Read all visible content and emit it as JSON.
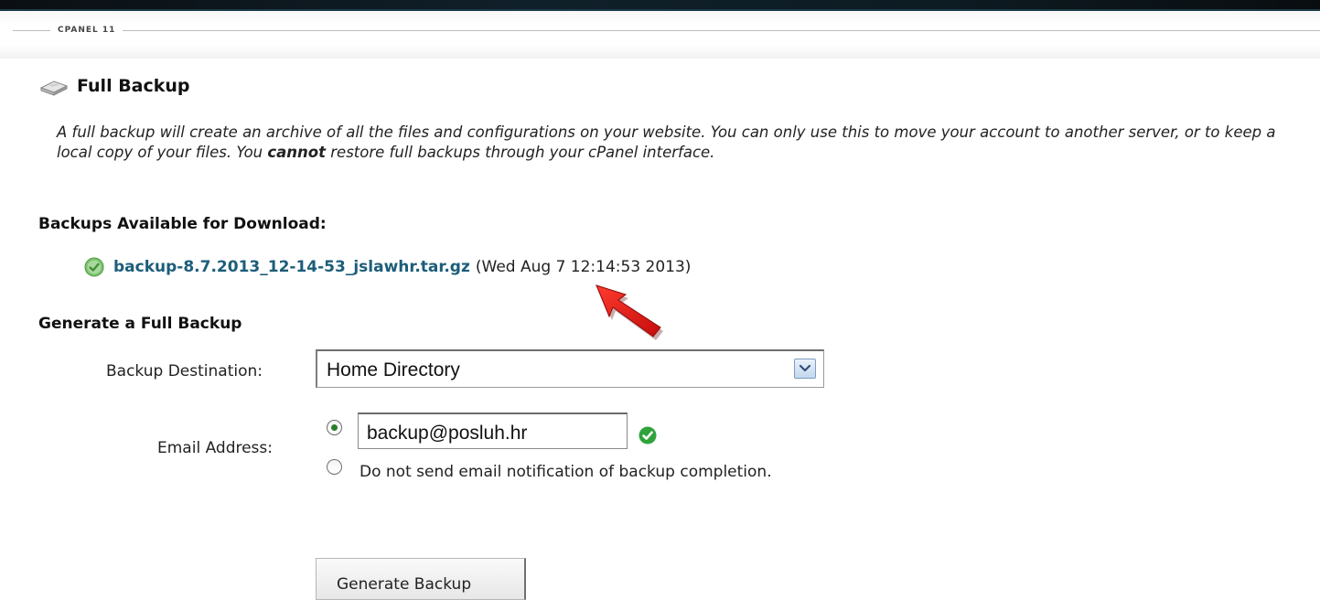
{
  "header": {
    "brand_label": "CPANEL 11"
  },
  "page": {
    "title": "Full Backup",
    "title_icon": "hard-drive-icon",
    "description_part1": "A full backup will create an archive of all the files and configurations on your website. You can only use this to move your account to another server, or to keep a local copy of your files. You ",
    "description_emphasis": "cannot",
    "description_part2": " restore full backups through your cPanel interface."
  },
  "backups_available": {
    "heading": "Backups Available for Download:",
    "items": [
      {
        "filename": "backup-8.7.2013_12-14-53_jslawhr.tar.gz",
        "date": "(Wed Aug 7 12:14:53 2013)",
        "status_icon": "green-check-circle-icon"
      }
    ]
  },
  "generate": {
    "heading": "Generate a Full Backup",
    "destination_label": "Backup Destination:",
    "destination_value": "Home Directory",
    "email_label": "Email Address:",
    "email_value": "backup@posluh.hr",
    "email_selected": true,
    "no_email_label": "Do not send email notification of backup completion.",
    "button_label": "Generate Backup"
  },
  "annotations": {
    "arrow_color": "#e01010"
  },
  "colors": {
    "link": "#1c5d7a",
    "check_green": "#3aa83a"
  }
}
